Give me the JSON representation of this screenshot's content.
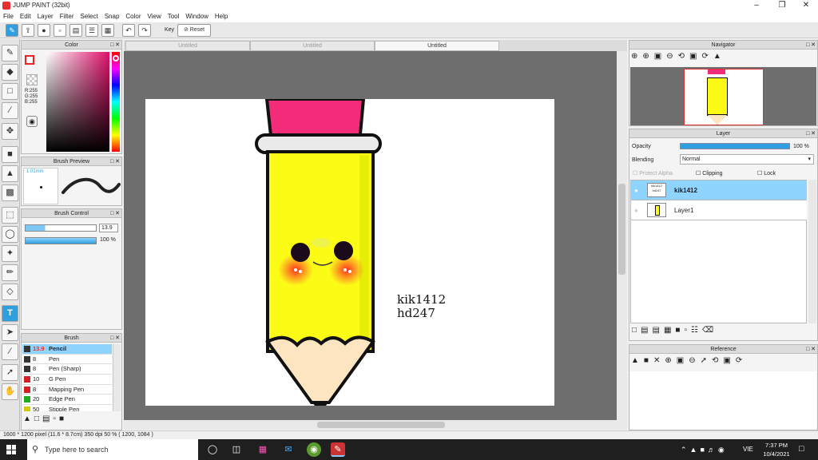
{
  "window": {
    "title": "JUMP PAINT (32bit)"
  },
  "menu": [
    "File",
    "Edit",
    "Layer",
    "Filter",
    "Select",
    "Snap",
    "Color",
    "View",
    "Tool",
    "Window",
    "Help"
  ],
  "toolbar": {
    "key_label": "Key",
    "reset_label": "Reset"
  },
  "doc_tabs": [
    "Untitled",
    "Untitled",
    "Untitled"
  ],
  "color_panel": {
    "title": "Color",
    "r": "R:255",
    "g": "G:255",
    "b": "B:255"
  },
  "brush_preview": {
    "title": "Brush Preview",
    "size": "1.01mm"
  },
  "brush_control": {
    "title": "Brush Control",
    "size_value": "13.9",
    "opacity_value": "100 %"
  },
  "brush_panel": {
    "title": "Brush",
    "items": [
      {
        "size": "13.9",
        "name": "Pencil",
        "color": "#333333"
      },
      {
        "size": "8",
        "name": "Pen",
        "color": "#333333"
      },
      {
        "size": "8",
        "name": "Pen (Sharp)",
        "color": "#333333"
      },
      {
        "size": "10",
        "name": "G Pen",
        "color": "#d42020"
      },
      {
        "size": "8",
        "name": "Mapping Pen",
        "color": "#d42020"
      },
      {
        "size": "20",
        "name": "Edge Pen",
        "color": "#22aa22"
      },
      {
        "size": "50",
        "name": "Stipple Pen",
        "color": "#d4c800"
      }
    ]
  },
  "canvas": {
    "text_line1": "kik1412",
    "text_line2": "hd247"
  },
  "navigator": {
    "title": "Navigator"
  },
  "layer_panel": {
    "title": "Layer",
    "opacity_label": "Opacity",
    "opacity_value": "100 %",
    "opacity_fraction": 1.0,
    "blending_label": "Blending",
    "blending_value": "Normal",
    "protect_alpha": "Protect Alpha",
    "clipping": "Clipping",
    "lock": "Lock",
    "layers": [
      {
        "name": "kik1412",
        "selected": true
      },
      {
        "name": "Layer1",
        "selected": false
      }
    ]
  },
  "reference": {
    "title": "Reference"
  },
  "status": {
    "text": "1600 * 1200 pixel   (11.6 * 8.7cm)   350 dpi   50 %   ( 1200, 1084 )"
  },
  "taskbar": {
    "search_placeholder": "Type here to search",
    "time": "7:37 PM",
    "date": "10/4/2021",
    "lang": "VIE"
  },
  "colors": {
    "accent": "#2f9fe0",
    "pencil_yellow": "#fbfb16",
    "eraser_pink": "#f32c7a",
    "wood": "#fde5c2"
  }
}
